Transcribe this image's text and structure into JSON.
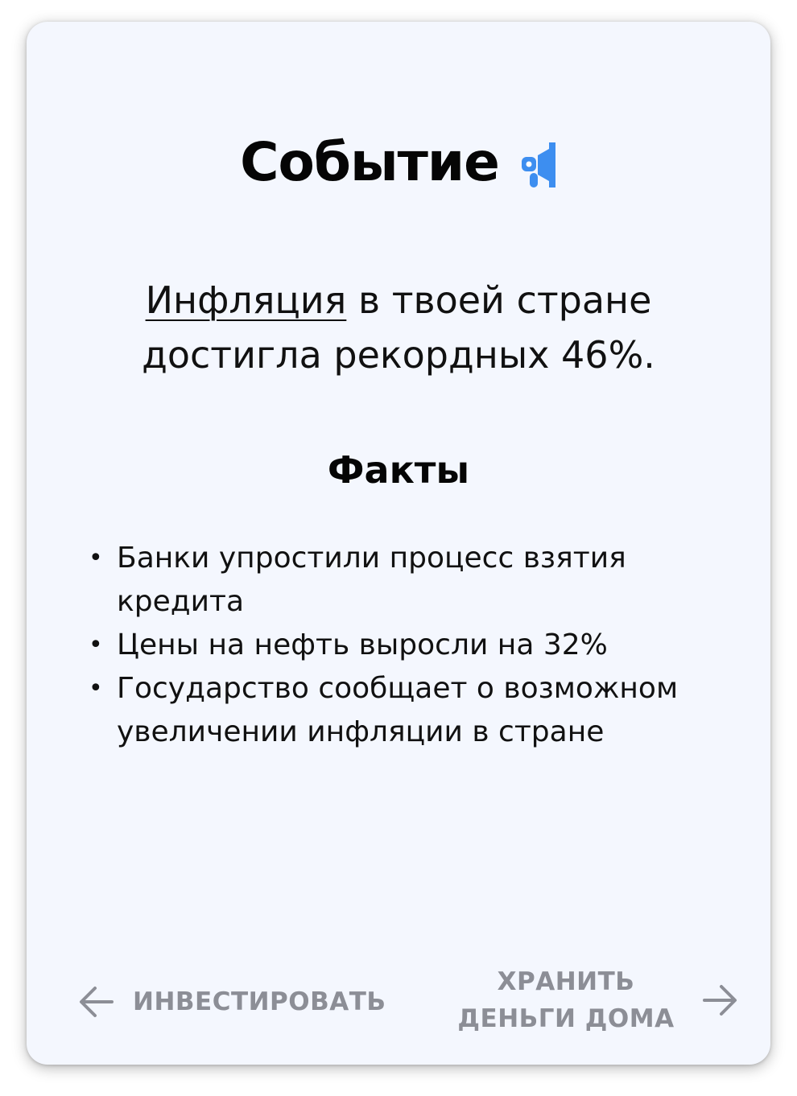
{
  "card": {
    "title": "Событие",
    "title_icon": "megaphone-icon",
    "event": {
      "term": "Инфляция",
      "text": " в твоей стране достигла рекордных 46%."
    },
    "facts_heading": "Факты",
    "facts": [
      "Банки упростили процесс взятия кредита",
      "Цены на нефть выросли на 32%",
      "Государство сообщает о возможном увеличении инфляции в стране"
    ],
    "bullet": "•"
  },
  "actions": {
    "left": {
      "label": "ИНВЕСТИРОВАТЬ",
      "icon": "arrow-left-icon"
    },
    "right": {
      "label": "ХРАНИТЬ ДЕНЬГИ ДОМА",
      "icon": "arrow-right-icon"
    }
  },
  "colors": {
    "card_background": "#f4f7fe",
    "action_text": "#8c8e96",
    "icon_blue": "#3d8ef0"
  }
}
